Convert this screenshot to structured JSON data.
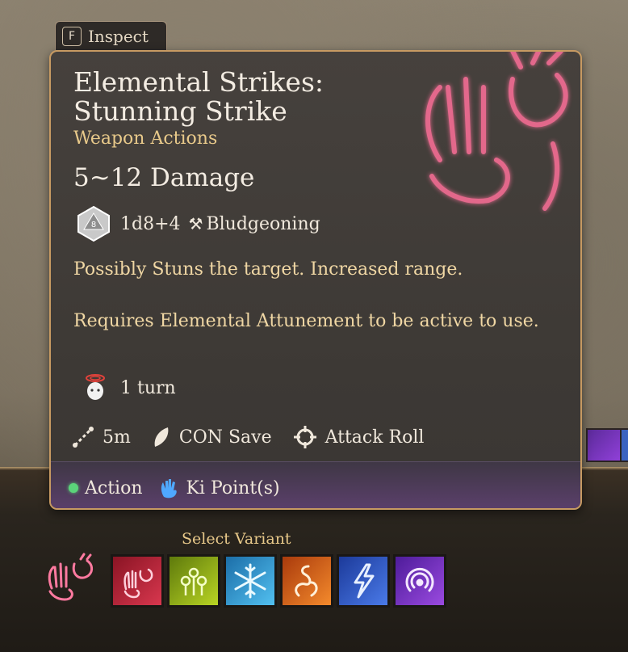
{
  "inspect": {
    "key": "F",
    "label": "Inspect"
  },
  "tooltip": {
    "title_line1": "Elemental Strikes:",
    "title_line2": "Stunning Strike",
    "subtitle": "Weapon Actions",
    "damage": "5~12 Damage",
    "dice": "1d8+4",
    "damage_type": "Bludgeoning",
    "description": "Possibly Stuns the target. Increased range.",
    "requirement": "Requires Elemental Attunement to be active to use.",
    "duration": "1 turn",
    "range": "5m",
    "save": "CON Save",
    "attack": "Attack Roll",
    "cost_action": "Action",
    "cost_ki": "Ki Point(s)"
  },
  "variant_bar": {
    "label": "Select Variant",
    "variants": [
      {
        "icon": "stunning-strike-hand-icon",
        "color": "#c8283e"
      },
      {
        "icon": "poison-cloud-icon",
        "color": "#9fbf1e"
      },
      {
        "icon": "snowflake-icon",
        "color": "#2a9ad8"
      },
      {
        "icon": "fire-swirl-icon",
        "color": "#e2661c"
      },
      {
        "icon": "lightning-icon",
        "color": "#2e5cc8"
      },
      {
        "icon": "thunder-wave-icon",
        "color": "#7b36c8"
      }
    ]
  },
  "colors": {
    "title": "#f3ece2",
    "subtitle": "#e8c98a",
    "description": "#f0d7a4",
    "border": "#c79a62",
    "glyph": "#ff5a8a"
  }
}
